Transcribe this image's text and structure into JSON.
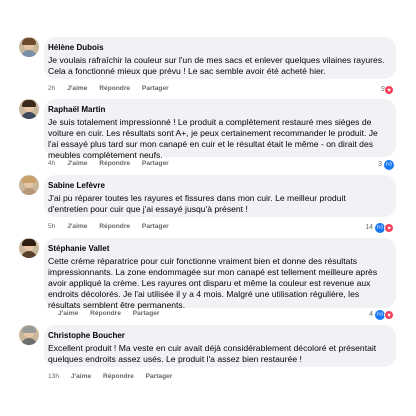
{
  "colors": {
    "bubble": "#f0f2f5",
    "meta": "#65676b",
    "like": "#1877f2",
    "love": "#f33e58"
  },
  "labels": {
    "like": "J'aime",
    "reply": "Répondre",
    "share": "Partager"
  },
  "comments": [
    {
      "author": "Hélène Dubois",
      "text": "Je voulais rafraîchir la couleur sur l'un de mes sacs et enlever quelques vilaines rayures. Cela a fonctionné mieux que prévu ! Le sac semble avoir été acheté hier.",
      "time": "2h",
      "reactions": "9",
      "reaction_icons": [
        "heart-icon"
      ]
    },
    {
      "author": "Raphaël Martin",
      "text": "Je suis totalement impressionné ! Le produit a complètement restauré mes sièges de voiture en cuir. Les résultats sont A+, je peux certainement recommander le produit. Je l'ai essayé plus tard sur mon canapé en cuir et le résultat était le même - on dirait des meubles complètement neufs.",
      "time": "4h",
      "reactions": "3",
      "reaction_icons": [
        "like-icon"
      ]
    },
    {
      "author": "Sabine Lefèvre",
      "text": "J'ai pu réparer toutes les rayures et fissures dans mon cuir. Le meilleur produit d'entretien pour cuir que j'ai essayé jusqu'à présent !",
      "time": "5h",
      "reactions": "14",
      "reaction_icons": [
        "like-icon",
        "heart-icon"
      ]
    },
    {
      "author": "Stéphanie Vallet",
      "text": "Cette crème réparatrice pour cuir fonctionne vraiment bien et donne des résultats impressionnants. La zone endommagée sur mon canapé est tellement meilleure après avoir appliqué la crème. Les rayures ont disparu et même la couleur est revenue aux endroits décolorés. Je l'ai utilisée il y a 4 mois. Malgré une utilisation régulière, les résultats semblent être permanents.",
      "time": "",
      "reactions": "4",
      "reaction_icons": [
        "like-icon",
        "heart-icon"
      ]
    },
    {
      "author": "Christophe Boucher",
      "text": "Excellent produit ! Ma veste en cuir avait déjà considérablement décoloré et présentait quelques endroits assez usés. Le produit l'a assez bien restaurée !",
      "time": "13h",
      "reactions": "",
      "reaction_icons": []
    }
  ]
}
